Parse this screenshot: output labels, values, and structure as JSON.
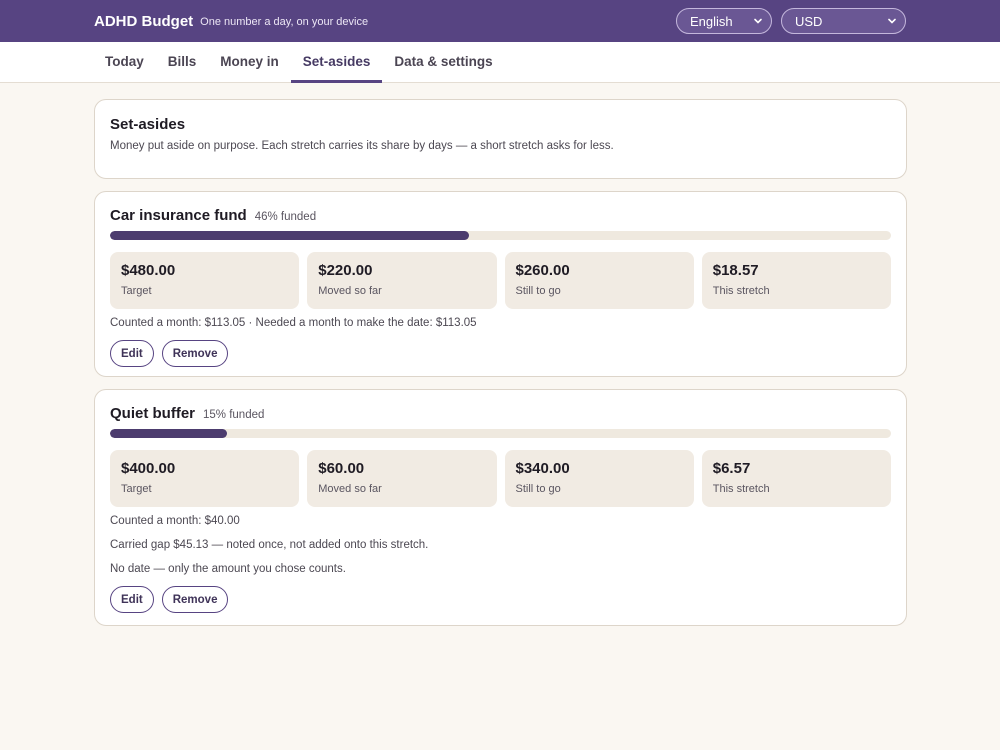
{
  "header": {
    "brand": "ADHD Budget",
    "tagline": "One number a day, on your device",
    "language": "English",
    "currency": "USD"
  },
  "tabs": [
    {
      "label": "Today"
    },
    {
      "label": "Bills"
    },
    {
      "label": "Money in"
    },
    {
      "label": "Set-asides",
      "active": true
    },
    {
      "label": "Data & settings"
    }
  ],
  "intro": {
    "title": "Set-asides",
    "description": "Money put aside on purpose. Each stretch carries its share by days — a short stretch asks for less."
  },
  "funds": [
    {
      "name": "Car insurance fund",
      "funded_label": "46% funded",
      "progress": 0.46,
      "stats": [
        {
          "value": "$480.00",
          "label": "Target"
        },
        {
          "value": "$220.00",
          "label": "Moved so far"
        },
        {
          "value": "$260.00",
          "label": "Still to go"
        },
        {
          "value": "$18.57",
          "label": "This stretch"
        }
      ],
      "notes": [
        "Counted a month: $113.05 · Needed a month to make the date: $113.05"
      ],
      "edit_label": "Edit",
      "remove_label": "Remove"
    },
    {
      "name": "Quiet buffer",
      "funded_label": "15% funded",
      "progress": 0.15,
      "stats": [
        {
          "value": "$400.00",
          "label": "Target"
        },
        {
          "value": "$60.00",
          "label": "Moved so far"
        },
        {
          "value": "$340.00",
          "label": "Still to go"
        },
        {
          "value": "$6.57",
          "label": "This stretch"
        }
      ],
      "notes": [
        "Counted a month: $40.00",
        "Carried gap $45.13 — noted once, not added onto this stretch.",
        "No date — only the amount you chose counts."
      ],
      "edit_label": "Edit",
      "remove_label": "Remove"
    }
  ],
  "colors": {
    "header_bg": "#574482",
    "accent": "#4c3c6e",
    "page_bg": "#faf7f2",
    "stat_bg": "#f1ebe3"
  }
}
